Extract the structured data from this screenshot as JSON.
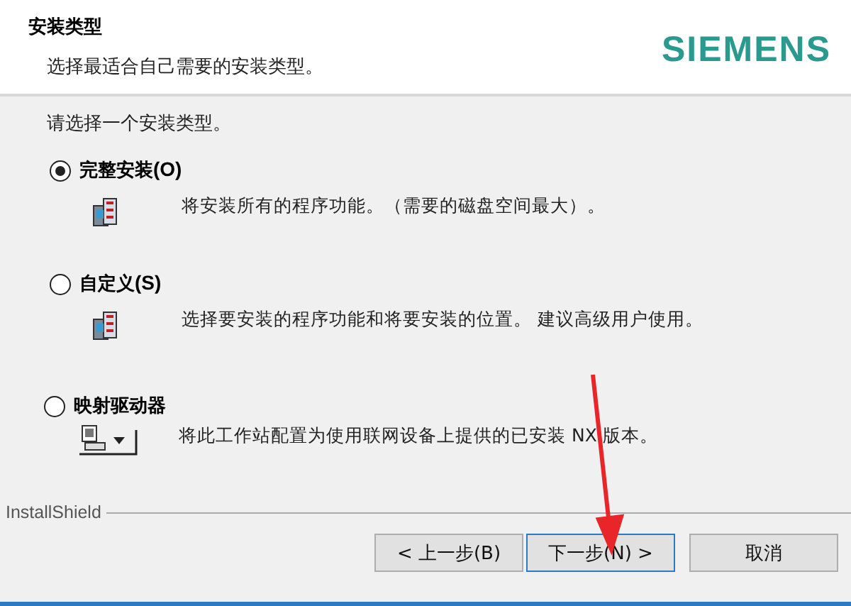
{
  "header": {
    "title": "安装类型",
    "subtitle": "选择最适合自己需要的安装类型。",
    "logo": "SIEMENS"
  },
  "prompt": "请选择一个安装类型。",
  "options": [
    {
      "label": "完整安装",
      "hotkey": "(O)",
      "description": "将安装所有的程序功能。（需要的磁盘空间最大）。",
      "selected": true,
      "kind": "package"
    },
    {
      "label": "自定义",
      "hotkey": "(S)",
      "description": "选择要安装的程序功能和将要安装的位置。 建议高级用户使用。",
      "selected": false,
      "kind": "package"
    },
    {
      "label": "映射驱动器",
      "description": "将此工作站配置为使用联网设备上提供的已安装 NX 版本。",
      "selected": false,
      "kind": "drive"
    }
  ],
  "footer": {
    "brand": "InstallShield"
  },
  "buttons": [
    {
      "label": "< 上一步(B)",
      "focused": false
    },
    {
      "label": "下一步(N) >",
      "focused": true
    },
    {
      "label": "取消",
      "focused": false
    }
  ]
}
